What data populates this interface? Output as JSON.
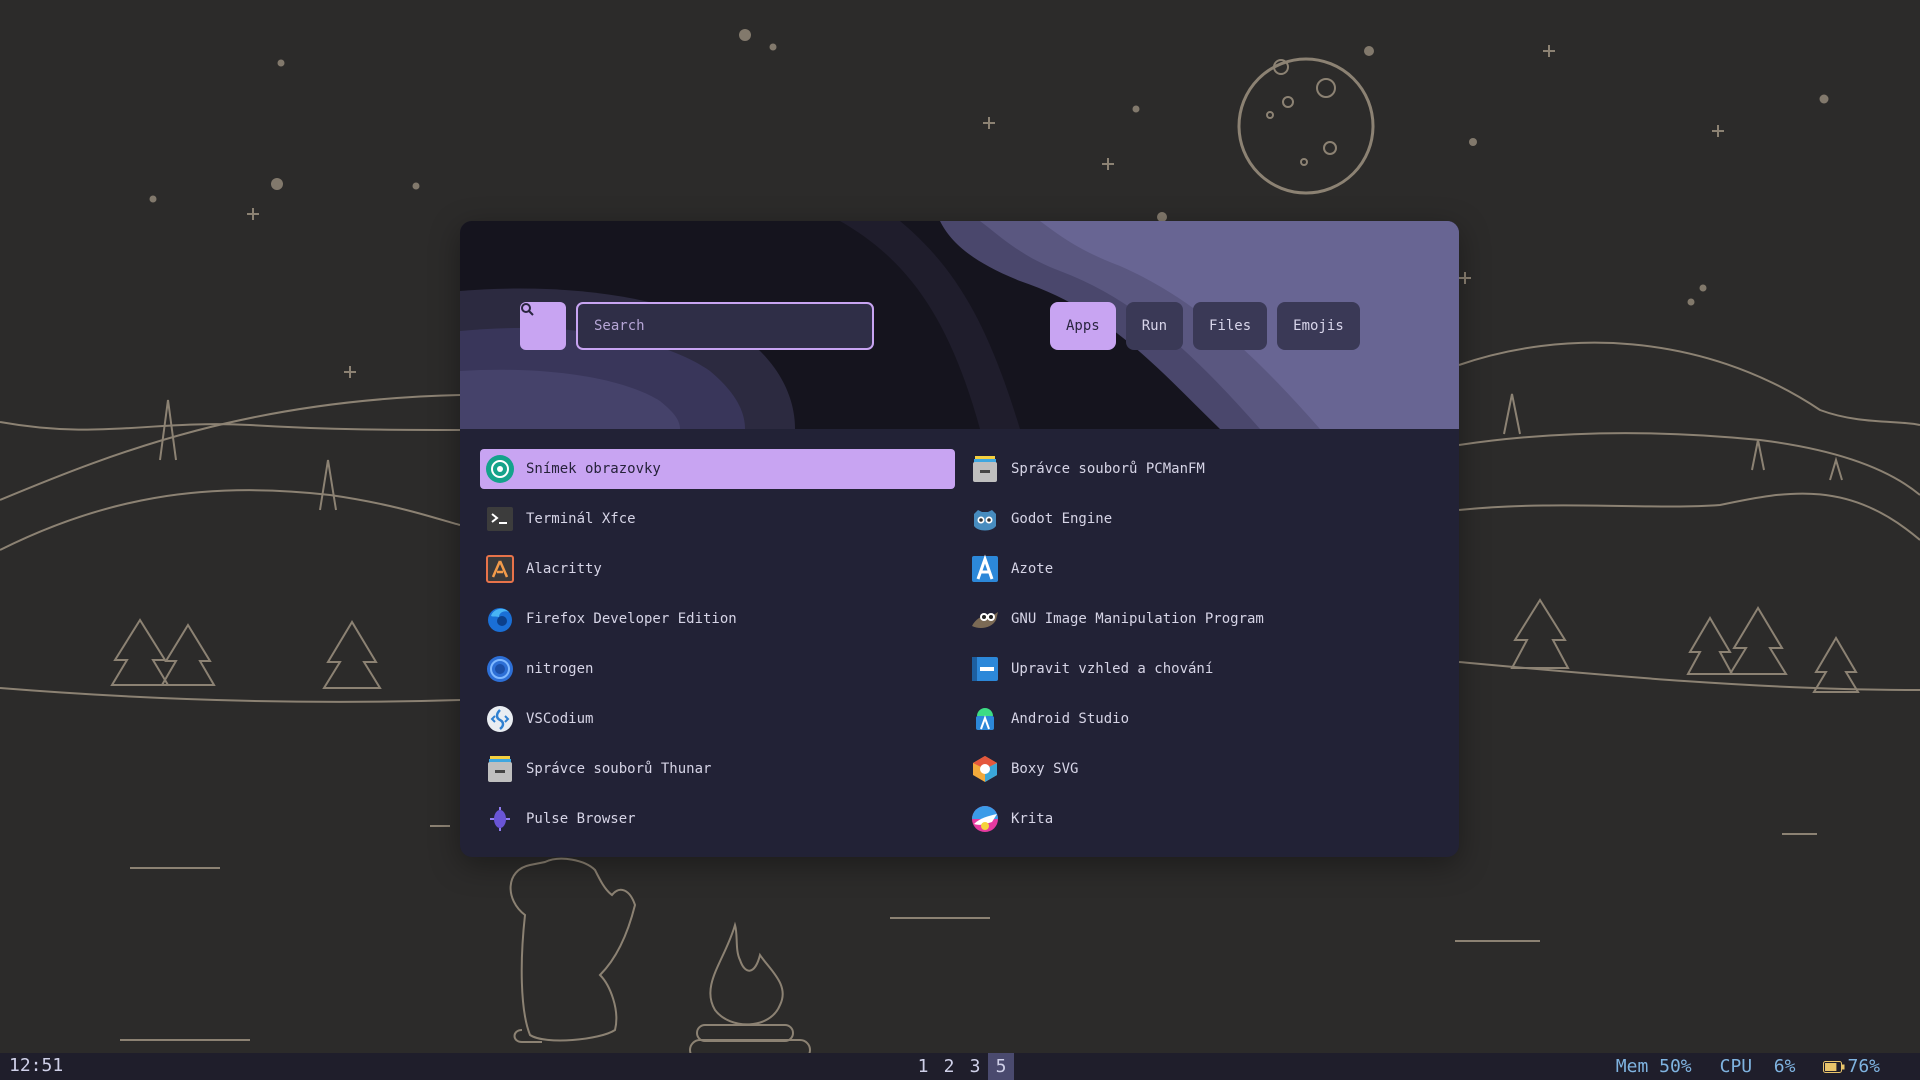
{
  "colors": {
    "accent": "#c8a4f2",
    "panel": "#222236",
    "desktop": "#2c2b2a",
    "line_art": "#9a8d78"
  },
  "launcher": {
    "search": {
      "placeholder": "Search",
      "icon": "search-icon"
    },
    "modes": [
      {
        "label": "Apps",
        "active": true
      },
      {
        "label": "Run",
        "active": false
      },
      {
        "label": "Files",
        "active": false
      },
      {
        "label": "Emojis",
        "active": false
      }
    ],
    "apps": [
      {
        "label": "Snímek obrazovky",
        "icon": "screenshot-icon",
        "selected": true
      },
      {
        "label": "Správce souborů PCManFM",
        "icon": "file-manager-icon"
      },
      {
        "label": "Terminál Xfce",
        "icon": "terminal-icon"
      },
      {
        "label": "Godot Engine",
        "icon": "godot-icon"
      },
      {
        "label": "Alacritty",
        "icon": "alacritty-icon"
      },
      {
        "label": "Azote",
        "icon": "azote-icon"
      },
      {
        "label": "Firefox Developer Edition",
        "icon": "firefox-icon"
      },
      {
        "label": "GNU Image Manipulation Program",
        "icon": "gimp-icon"
      },
      {
        "label": "nitrogen",
        "icon": "nitrogen-icon"
      },
      {
        "label": "Upravit vzhled a chování",
        "icon": "appearance-icon"
      },
      {
        "label": "VSCodium",
        "icon": "vscodium-icon"
      },
      {
        "label": "Android Studio",
        "icon": "android-studio-icon"
      },
      {
        "label": "Správce souborů Thunar",
        "icon": "file-manager-icon"
      },
      {
        "label": "Boxy SVG",
        "icon": "boxy-svg-icon"
      },
      {
        "label": "Pulse Browser",
        "icon": "pulse-icon"
      },
      {
        "label": "Krita",
        "icon": "krita-icon"
      }
    ]
  },
  "taskbar": {
    "clock": "12:51",
    "workspaces": [
      {
        "label": "1",
        "active": false
      },
      {
        "label": "2",
        "active": false
      },
      {
        "label": "3",
        "active": false
      },
      {
        "label": "5",
        "active": true
      }
    ],
    "mem": "Mem 50%",
    "cpu": "CPU  6%",
    "battery": "76%",
    "battery_level": 0.76
  }
}
